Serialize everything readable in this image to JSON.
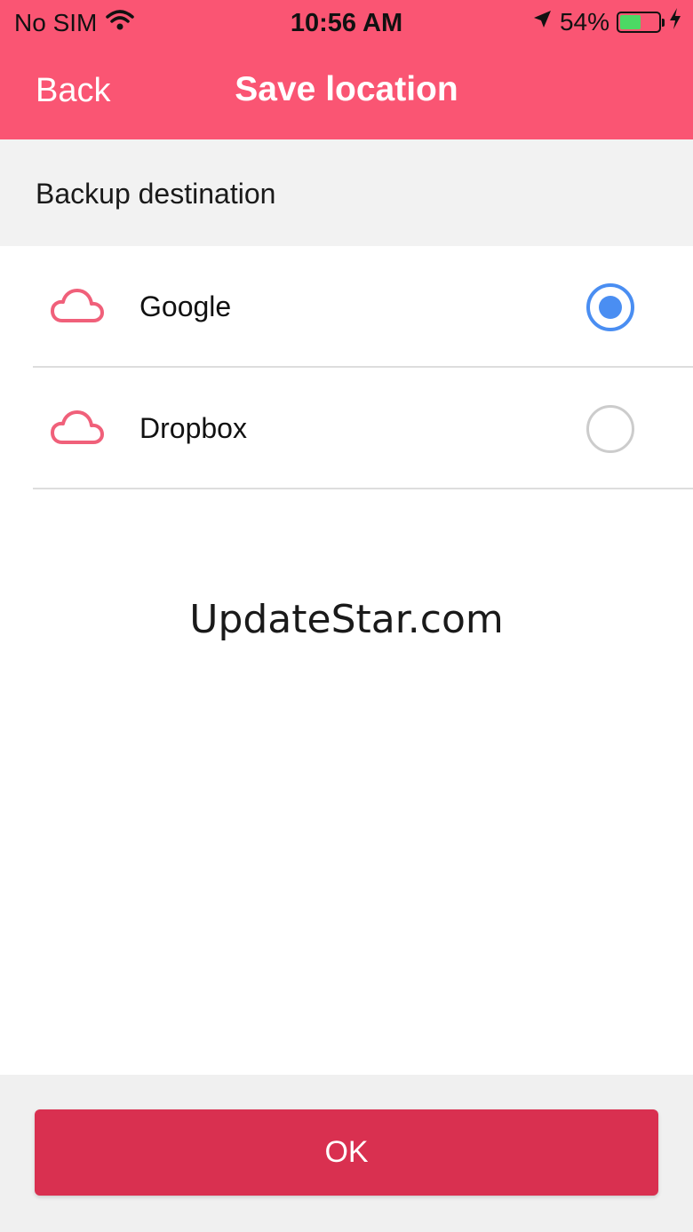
{
  "status_bar": {
    "carrier": "No SIM",
    "time": "10:56 AM",
    "battery_percent": "54%",
    "battery_level": 0.54,
    "icons": [
      "wifi-icon",
      "location-arrow-icon",
      "battery-icon",
      "charging-bolt-icon"
    ]
  },
  "nav": {
    "back_label": "Back",
    "title": "Save location"
  },
  "section": {
    "title": "Backup destination"
  },
  "options": [
    {
      "label": "Google",
      "icon": "cloud-icon",
      "selected": true
    },
    {
      "label": "Dropbox",
      "icon": "cloud-icon",
      "selected": false
    }
  ],
  "watermark": "UpdateStar.com",
  "footer": {
    "ok_label": "OK"
  },
  "colors": {
    "header": "#fa5573",
    "accent_radio": "#4a8ef2",
    "cloud_icon": "#f0607a",
    "ok_button": "#d93050"
  }
}
